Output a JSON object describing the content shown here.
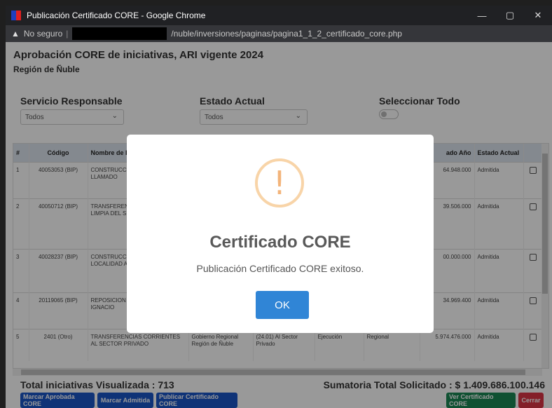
{
  "window": {
    "title": "Publicación Certificado CORE - Google Chrome",
    "controls": {
      "minimize": "—",
      "maximize": "▢",
      "close": "✕"
    }
  },
  "address": {
    "security": "No seguro",
    "url": "/nuble/inversiones/paginas/pagina1_1_2_certificado_core.php"
  },
  "header": {
    "title": "Aprobación CORE de iniciativas, ARI vigente 2024",
    "region": "Región de Ñuble"
  },
  "filters": {
    "servicio_label": "Servicio Responsable",
    "servicio_value": "Todos",
    "estado_label": "Estado Actual",
    "estado_value": "Todos",
    "select_all_label": "Seleccionar Todo"
  },
  "table": {
    "headers": [
      "#",
      "Código",
      "Nombre de I",
      "",
      "",
      "",
      "",
      "ado Año",
      "Estado Actual",
      ""
    ],
    "rows": [
      {
        "n": "1",
        "code": "40053053 (BIP)",
        "name": "CONSTRUCC PAVIMENTAC 33 LLAMADO",
        "c3": "",
        "c4": "",
        "c5": "",
        "c6": "",
        "amount": "64.948.000",
        "estado": "Admitida"
      },
      {
        "n": "2",
        "code": "40050712 (BIP)",
        "name": "TRANSFEREN TECNOLOGIC LIMPIA DEL S ÑUBLE",
        "c3": "",
        "c4": "",
        "c5": "",
        "c6": "",
        "amount": "39.506.000",
        "estado": "Admitida"
      },
      {
        "n": "3",
        "code": "40028237 (BIP)",
        "name": "CONSTRUCC ALCANTARIL LOCALIDAD ALICO",
        "c3": "",
        "c4": "",
        "c5": "",
        "c6": "",
        "amount": "00.000.000",
        "estado": "Admitida"
      },
      {
        "n": "4",
        "code": "20119065 (BIP)",
        "name": "REPOSICION ANCIANOS C IGNACIO",
        "c3": "",
        "c4": "",
        "c5": "",
        "c6": "",
        "amount": "34.969.400",
        "estado": "Admitida"
      },
      {
        "n": "5",
        "code": "2401 (Otro)",
        "name": "TRANSFERENCIAS CORRIENTES AL SECTOR PRIVADO",
        "c3": "Gobierno Regional Región de Ñuble",
        "c4": "(24.01) Al Sector Privado",
        "c5": "Ejecución",
        "c6": "Regional",
        "amount": "5.974.476.000",
        "estado": "Admitida"
      }
    ]
  },
  "footer": {
    "total_visualizada": "Total iniciativas Visualizada : 713",
    "sumatoria": "Sumatoria Total Solicitado : $ 1.409.686.100.146",
    "buttons": {
      "aprobada": "Marcar Aprobada CORE",
      "admitida": "Marcar Admitida",
      "publicar": "Publicar Certificado CORE",
      "ver": "Ver Certificado CORE",
      "cerrar": "Cerrar"
    }
  },
  "modal": {
    "icon": "!",
    "title": "Certificado CORE",
    "text": "Publicación Certificado CORE exitoso.",
    "ok": "OK"
  },
  "colors": {
    "blue_button": "#1a56c7",
    "green_button": "#198754",
    "red_button": "#dc3545",
    "ok_button": "#3085d6",
    "warning_icon": "#f8bb86"
  }
}
